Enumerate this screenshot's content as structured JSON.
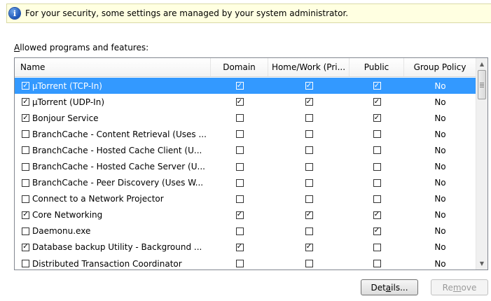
{
  "infobar": {
    "icon": "info-icon",
    "text": "For your security, some settings are managed by your system administrator."
  },
  "section_label": {
    "accel": "A",
    "rest": "llowed programs and features:"
  },
  "columns": {
    "name": "Name",
    "domain": "Domain",
    "home_work": "Home/Work (Pri...",
    "public": "Public",
    "group_policy": "Group Policy"
  },
  "rows": [
    {
      "name": "μTorrent (TCP-In)",
      "enabled": true,
      "domain": true,
      "home": true,
      "public": true,
      "gp": "No",
      "selected": true
    },
    {
      "name": "μTorrent (UDP-In)",
      "enabled": true,
      "domain": true,
      "home": true,
      "public": true,
      "gp": "No"
    },
    {
      "name": "Bonjour Service",
      "enabled": true,
      "domain": false,
      "home": false,
      "public": true,
      "gp": "No"
    },
    {
      "name": "BranchCache - Content Retrieval (Uses ...",
      "enabled": false,
      "domain": false,
      "home": false,
      "public": false,
      "gp": "No"
    },
    {
      "name": "BranchCache - Hosted Cache Client (U...",
      "enabled": false,
      "domain": false,
      "home": false,
      "public": false,
      "gp": "No"
    },
    {
      "name": "BranchCache - Hosted Cache Server (U...",
      "enabled": false,
      "domain": false,
      "home": false,
      "public": false,
      "gp": "No"
    },
    {
      "name": "BranchCache - Peer Discovery (Uses W...",
      "enabled": false,
      "domain": false,
      "home": false,
      "public": false,
      "gp": "No"
    },
    {
      "name": "Connect to a Network Projector",
      "enabled": false,
      "domain": false,
      "home": false,
      "public": false,
      "gp": "No"
    },
    {
      "name": "Core Networking",
      "enabled": true,
      "domain": true,
      "home": true,
      "public": true,
      "gp": "No"
    },
    {
      "name": "Daemonu.exe",
      "enabled": false,
      "domain": false,
      "home": false,
      "public": true,
      "gp": "No"
    },
    {
      "name": "Database backup Utility - Background ...",
      "enabled": true,
      "domain": true,
      "home": true,
      "public": false,
      "gp": "No"
    },
    {
      "name": "Distributed Transaction Coordinator",
      "enabled": false,
      "domain": false,
      "home": false,
      "public": false,
      "gp": "No"
    }
  ],
  "buttons": {
    "details": {
      "pre": "Det",
      "accel": "a",
      "post": "ils..."
    },
    "remove": {
      "pre": "Re",
      "accel": "m",
      "post": "ove"
    }
  },
  "colors": {
    "selection": "#3399ff",
    "infobar_bg": "#ffffe1"
  }
}
